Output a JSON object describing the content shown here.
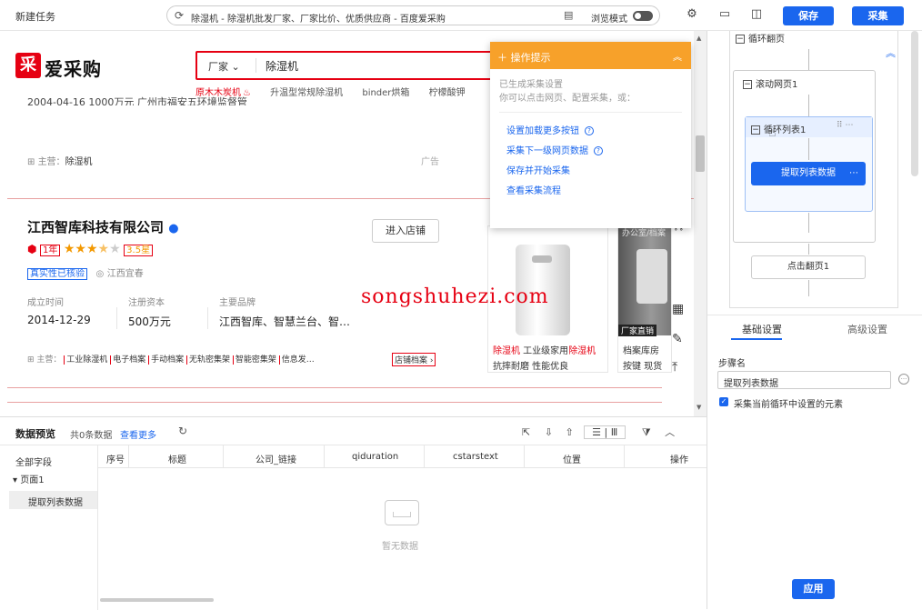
{
  "topbar": {
    "task_title": "新建任务",
    "url": "除湿机 - 除湿机批发厂家、厂家比价、优质供应商 - 百度爱采购",
    "browse_mode_label": "浏览模式",
    "save_label": "保存",
    "collect_label": "采集"
  },
  "site": {
    "logo_text": "爱采购",
    "logo_mark": "采",
    "search_category": "厂家",
    "search_query": "除湿机",
    "hotwords": [
      "原木木炭机",
      "升温型常规除湿机",
      "binder烘箱",
      "柠檬酸钾"
    ],
    "prev_card": {
      "row_partial": "2004-04-16        1000万元        广州市福安五环境监督管",
      "main_label": "主营：",
      "main_value": "除湿机",
      "ad_label": "广告"
    },
    "company": {
      "name": "江西智库科技有限公司",
      "years": "1年",
      "rating": "3.5星",
      "verified": "真实性已核验",
      "location": "江西宜春",
      "enter_shop": "进入店铺",
      "labels": [
        "成立时间",
        "注册资本",
        "主要品牌"
      ],
      "values": [
        "2014-12-29",
        "500万元",
        "江西智库、智慧兰台、智…"
      ],
      "main_label": "主营：",
      "main_items": [
        "工业除湿机",
        "电子档案",
        "手动档案",
        "无轨密集架",
        "智能密集架",
        "信息发…"
      ],
      "shop_archive": "店铺档案 ›",
      "product1_title_a": "除湿机",
      "product1_title_b": " 工业级家用",
      "product1_title_c": "除湿机",
      "product1_desc": "抗摔耐磨 性能优良",
      "product2_title": "档案库房",
      "product2_desc": "按键 现货",
      "product2_badge": "厂家直销",
      "product2_overlay": "办公室/档案"
    },
    "watermark": "songshuhezi.com"
  },
  "tips": {
    "title": "操作提示",
    "desc1": "已生成采集设置",
    "desc2": "你可以点击网页、配置采集，或：",
    "items": [
      "设置加载更多按钮",
      "采集下一级网页数据",
      "保存并开始采集",
      "查看采集流程"
    ]
  },
  "preview": {
    "title": "数据预览",
    "count": "共0条数据",
    "see_more": "查看更多",
    "all_fields": "全部字段",
    "page1": "页面1",
    "extract": "提取列表数据",
    "columns": [
      "序号",
      "标题",
      "公司_链接",
      "qiduration",
      "cstarstext",
      "位置",
      "操作"
    ],
    "empty": "暂无数据"
  },
  "flow": {
    "loop_page": "循环翻页",
    "scroll_page": "滚动网页1",
    "loop_list": "循环列表1",
    "extract": "提取列表数据",
    "click_page": "点击翻页1"
  },
  "settings": {
    "tab_basic": "基础设置",
    "tab_advanced": "高级设置",
    "step_name_label": "步骤名",
    "step_name_value": "提取列表数据",
    "checkbox_label": "采集当前循环中设置的元素",
    "apply": "应用"
  },
  "colors": {
    "accent": "#1a66ee",
    "brand": "#e60012",
    "tips": "#f7a12a"
  }
}
